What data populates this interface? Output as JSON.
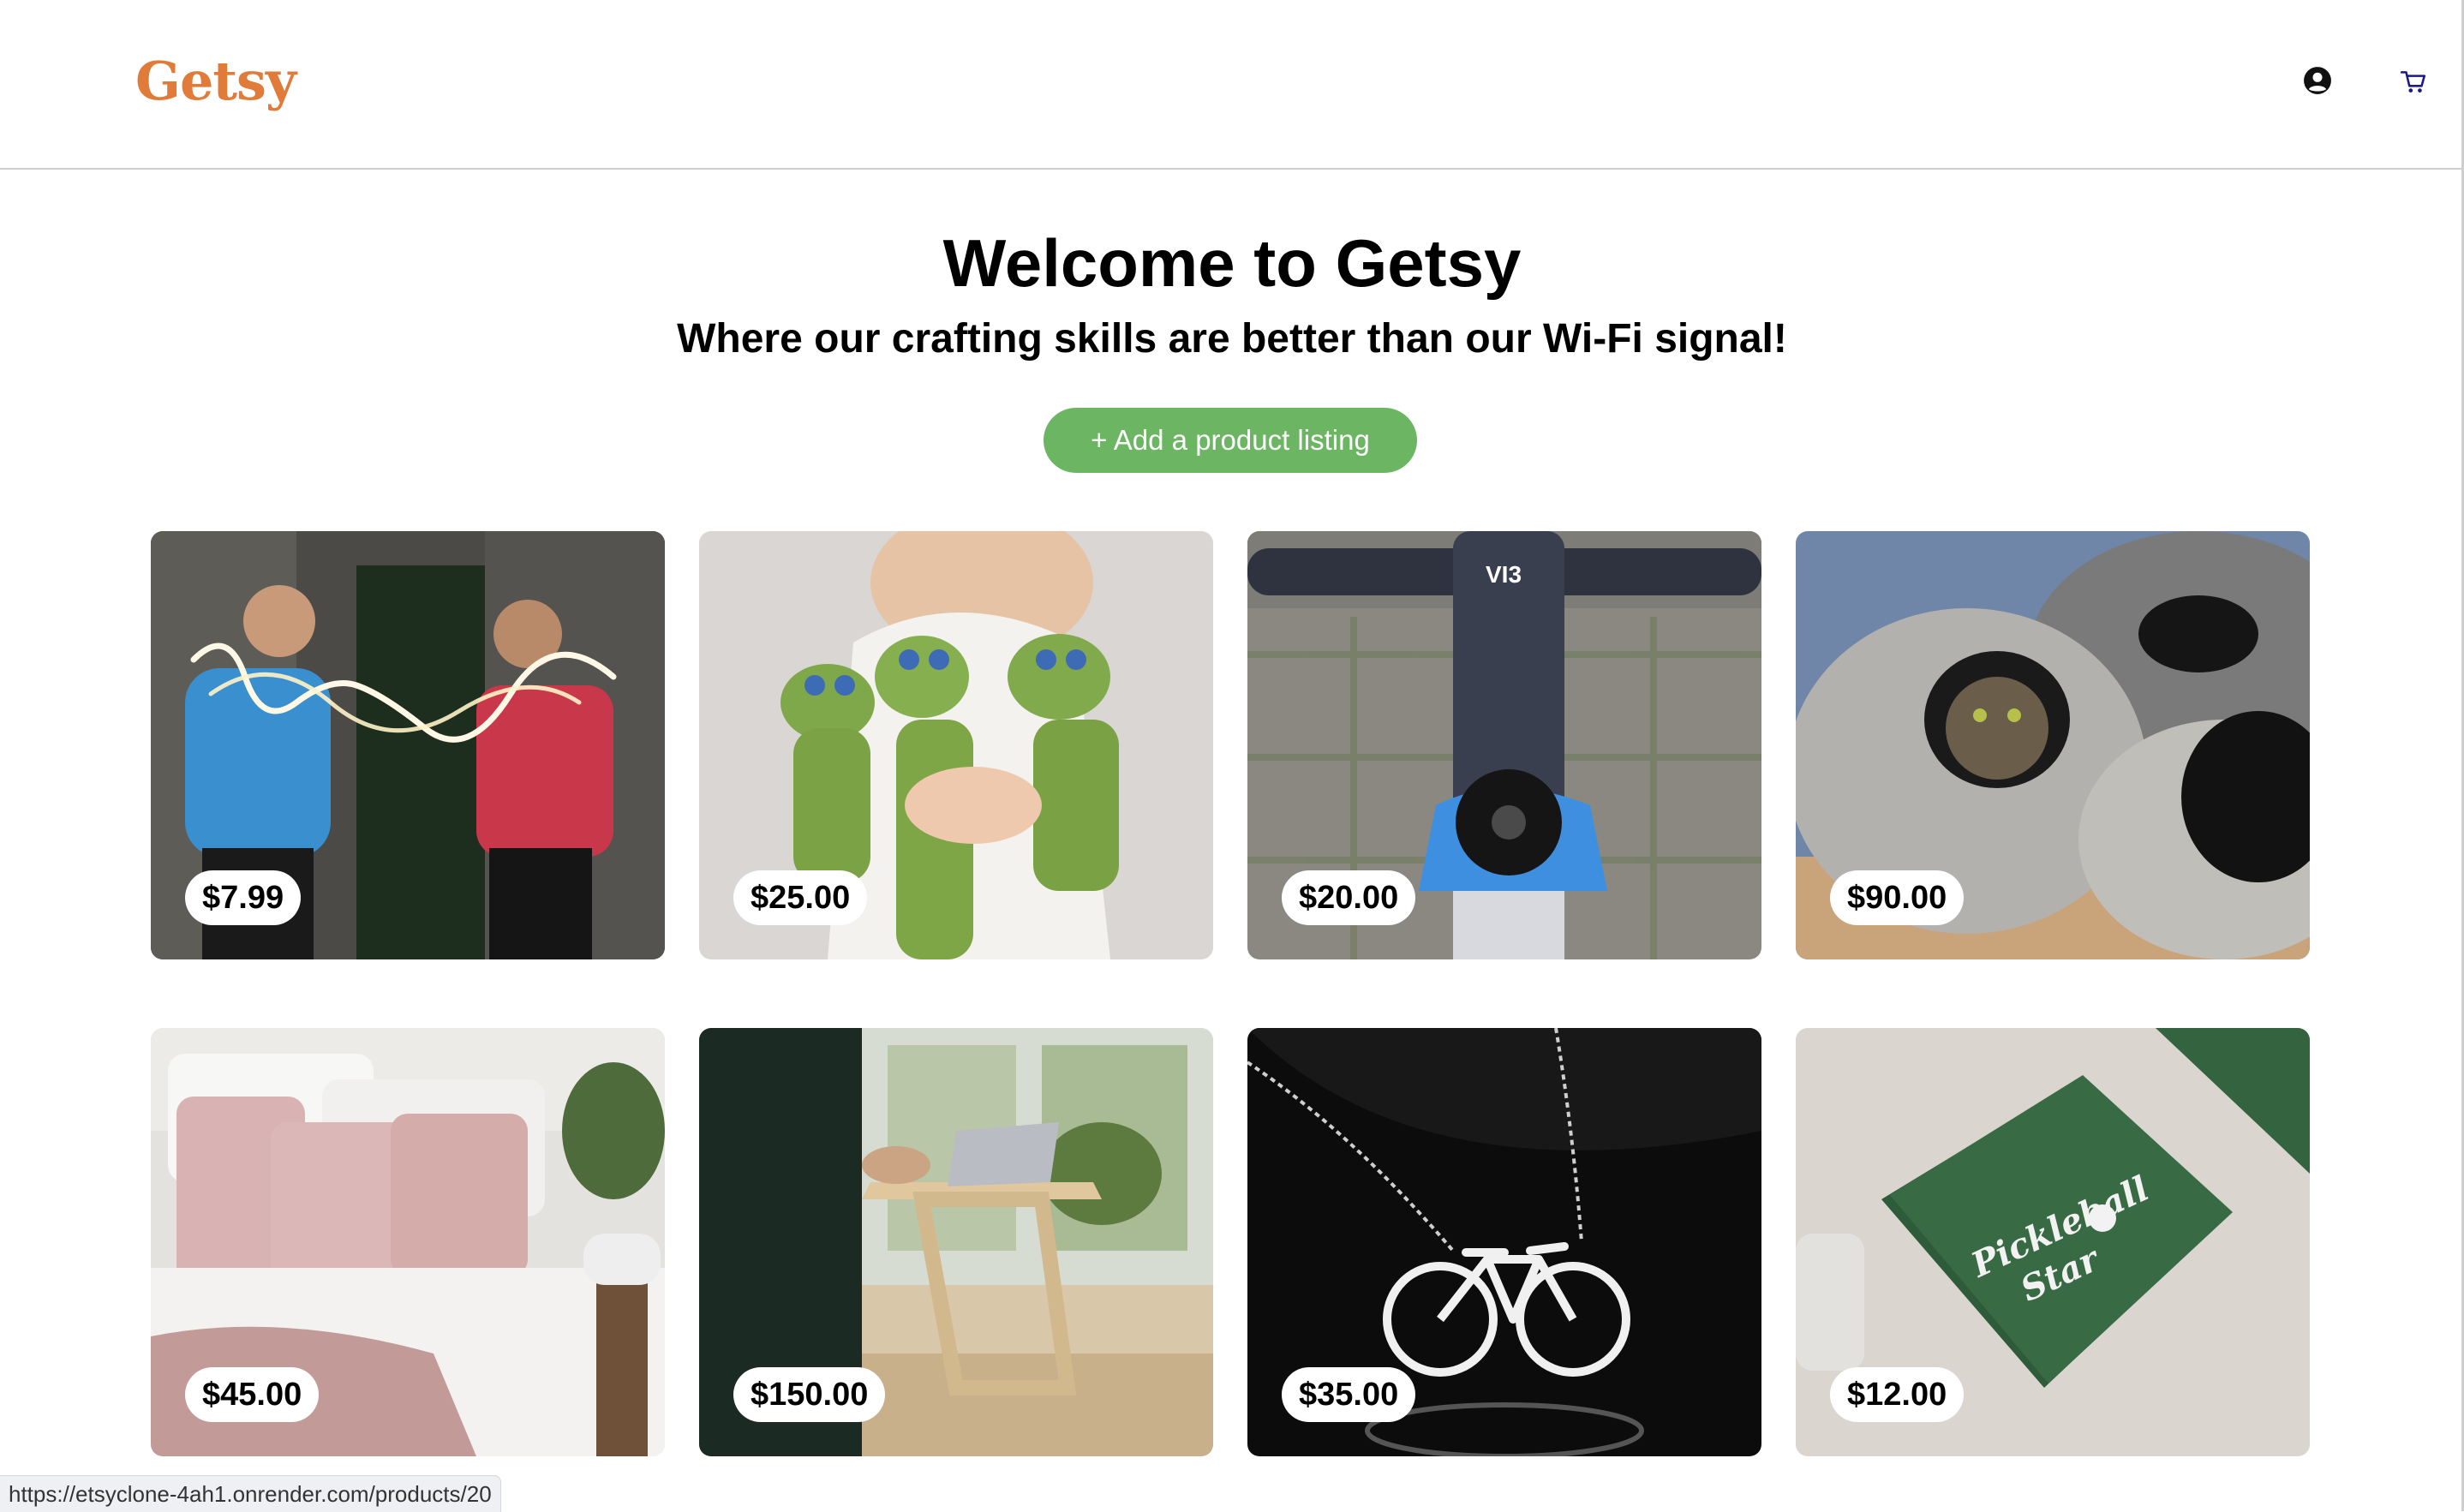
{
  "header": {
    "logo": "Getsy",
    "icons": [
      "user-circle-icon",
      "cart-icon"
    ]
  },
  "hero": {
    "title": "Welcome to Getsy",
    "subtitle": "Where our crafting skills are better than our Wi-Fi signal!",
    "add_button_label": "+ Add a product listing"
  },
  "products": [
    {
      "price": "$7.99",
      "image": "neon-sign-photo"
    },
    {
      "price": "$25.00",
      "image": "crochet-frogs-photo"
    },
    {
      "price": "$20.00",
      "image": "bike-stem-cap-photo"
    },
    {
      "price": "$90.00",
      "image": "felt-cat-cave-photo"
    },
    {
      "price": "$45.00",
      "image": "linen-bedding-photo"
    },
    {
      "price": "$150.00",
      "image": "standing-desk-photo"
    },
    {
      "price": "$35.00",
      "image": "bike-necklace-photo"
    },
    {
      "price": "$12.00",
      "image": "pickleball-napkins-photo"
    }
  ],
  "status_bar": {
    "url": "https://etsyclone-4ah1.onrender.com/products/20"
  },
  "colors": {
    "brand": "#e07b39",
    "button": "#6bb563"
  }
}
